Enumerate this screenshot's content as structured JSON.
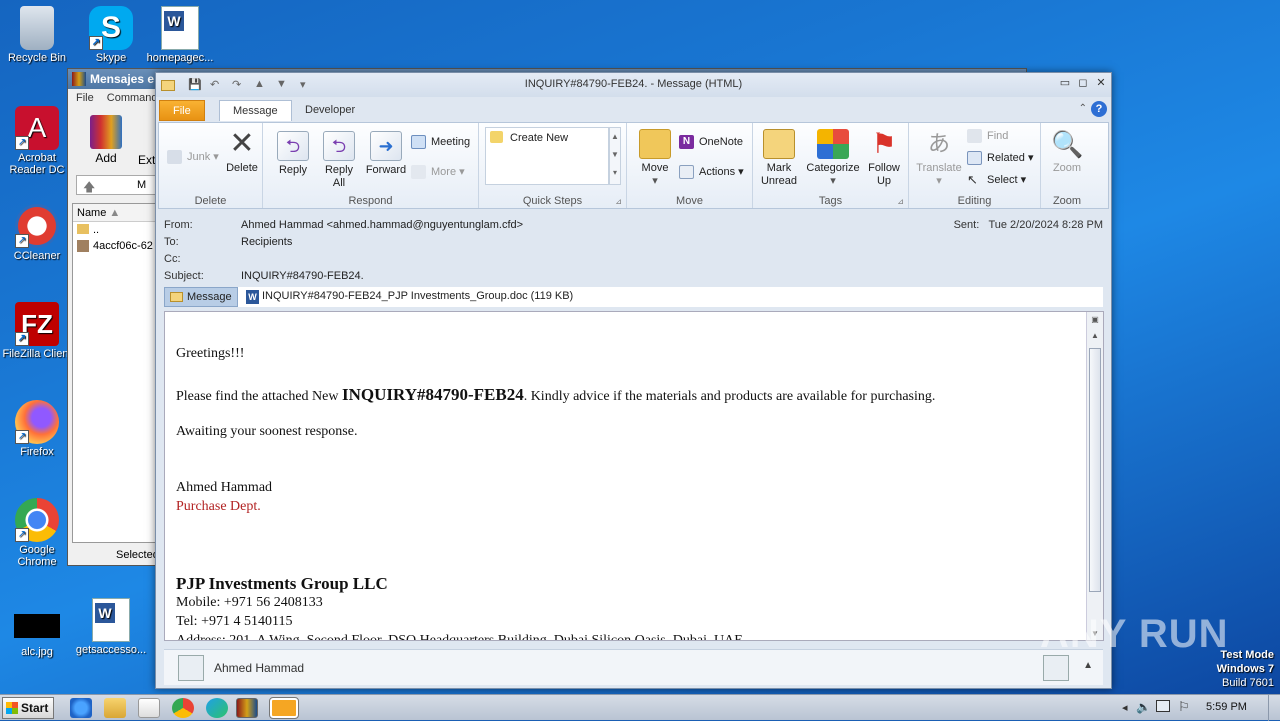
{
  "desktop": {
    "icons": [
      {
        "label": "Recycle Bin"
      },
      {
        "label": "Skype"
      },
      {
        "label": "homepagec..."
      },
      {
        "label": "Acrobat Reader DC"
      },
      {
        "label": "CCleaner"
      },
      {
        "label": "FileZilla Client"
      },
      {
        "label": "Firefox"
      },
      {
        "label": "Google Chrome"
      },
      {
        "label": "alc.jpg"
      },
      {
        "label": "getsaccesso..."
      }
    ]
  },
  "winrar": {
    "title": "Mensajes e",
    "menu": [
      "File",
      "Commands"
    ],
    "add_label": "Add",
    "ext_label": "Ext",
    "path_text": "M",
    "col_name": "Name",
    "rows": [
      "..",
      "4accf06c-62"
    ],
    "status": "Selected"
  },
  "outlook": {
    "title": "INQUIRY#84790-FEB24. - Message (HTML)",
    "tabs": {
      "file": "File",
      "message": "Message",
      "developer": "Developer"
    },
    "ribbon": {
      "delete_group": "Delete",
      "junk": "Junk",
      "delete": "Delete",
      "respond_group": "Respond",
      "reply": "Reply",
      "reply_all": "Reply All",
      "forward": "Forward",
      "meeting": "Meeting",
      "more": "More",
      "quicksteps_group": "Quick Steps",
      "create_new": "Create New",
      "move_group": "Move",
      "move": "Move",
      "onenote": "OneNote",
      "actions": "Actions",
      "tags_group": "Tags",
      "mark_unread": "Mark Unread",
      "categorize": "Categorize",
      "follow_up": "Follow Up",
      "editing_group": "Editing",
      "translate": "Translate",
      "find": "Find",
      "related": "Related",
      "select": "Select",
      "zoom_group": "Zoom",
      "zoom": "Zoom"
    },
    "header": {
      "from_label": "From:",
      "from_value": "Ahmed Hammad <ahmed.hammad@nguyentunglam.cfd>",
      "to_label": "To:",
      "to_value": "Recipients",
      "cc_label": "Cc:",
      "subject_label": "Subject:",
      "subject_value": "INQUIRY#84790-FEB24.",
      "sent_label": "Sent:",
      "sent_value": "Tue 2/20/2024 8:28 PM"
    },
    "attachments": {
      "message_tab": "Message",
      "file": "INQUIRY#84790-FEB24_PJP Investments_Group.doc (119 KB)"
    },
    "body": {
      "greeting": "Greetings!!!",
      "line1_pre": "Please find the attached New ",
      "line1_bold": "INQUIRY#84790-FEB24",
      "line1_post": ". Kindly advice if the materials and products are available for purchasing.",
      "line2": "Awaiting your soonest response.",
      "sig_name": "Ahmed Hammad",
      "sig_dept": "Purchase Dept.",
      "company": "PJP Investments Group LLC",
      "mobile": "Mobile: +971 56 2408133",
      "tel": "Tel: +971 4 5140115",
      "address": "Address: 201, A Wing, Second Floor, DSO Headquarters Building, Dubai Silicon Oasis, Dubai, UAE"
    },
    "footer_name": "Ahmed Hammad"
  },
  "taskbar": {
    "start": "Start",
    "clock": "5:59 PM"
  },
  "watermark": {
    "line1": "Test Mode",
    "line2": "Windows 7",
    "line3": "Build 7601",
    "brand": "ANY RUN"
  },
  "colors": {
    "accent": "#f5a623",
    "sig_red": "#b22222",
    "ribbon_tab_file": "#e89213"
  }
}
